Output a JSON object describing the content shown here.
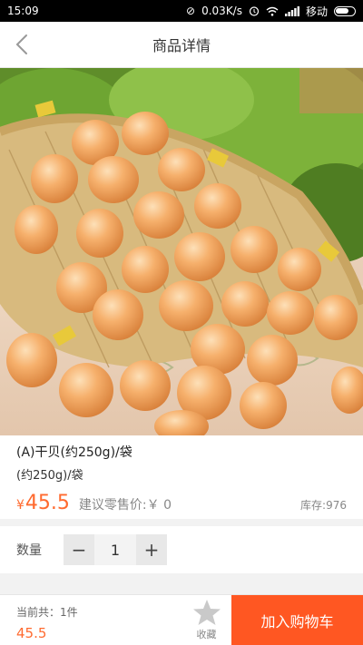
{
  "status_bar": {
    "time": "15:09",
    "network_speed": "0.03K/s",
    "carrier": "移动"
  },
  "nav": {
    "title": "商品详情",
    "back_icon": "chevron-left-icon"
  },
  "product": {
    "name": "(A)干贝(约250g)/袋",
    "spec": "(约250g)/袋",
    "price_symbol": "¥",
    "price": "45.5",
    "suggested_price": "建议零售价:￥ 0",
    "stock": "库存:976"
  },
  "quantity": {
    "label": "数量",
    "minus": "−",
    "value": "1",
    "plus": "+"
  },
  "bottom": {
    "total_label": "当前共：1件",
    "total_amount": "45.5",
    "favorite_label": "收藏",
    "add_to_cart": "加入购物车"
  },
  "colors": {
    "accent": "#ff5722",
    "price": "#ff6a2f"
  }
}
